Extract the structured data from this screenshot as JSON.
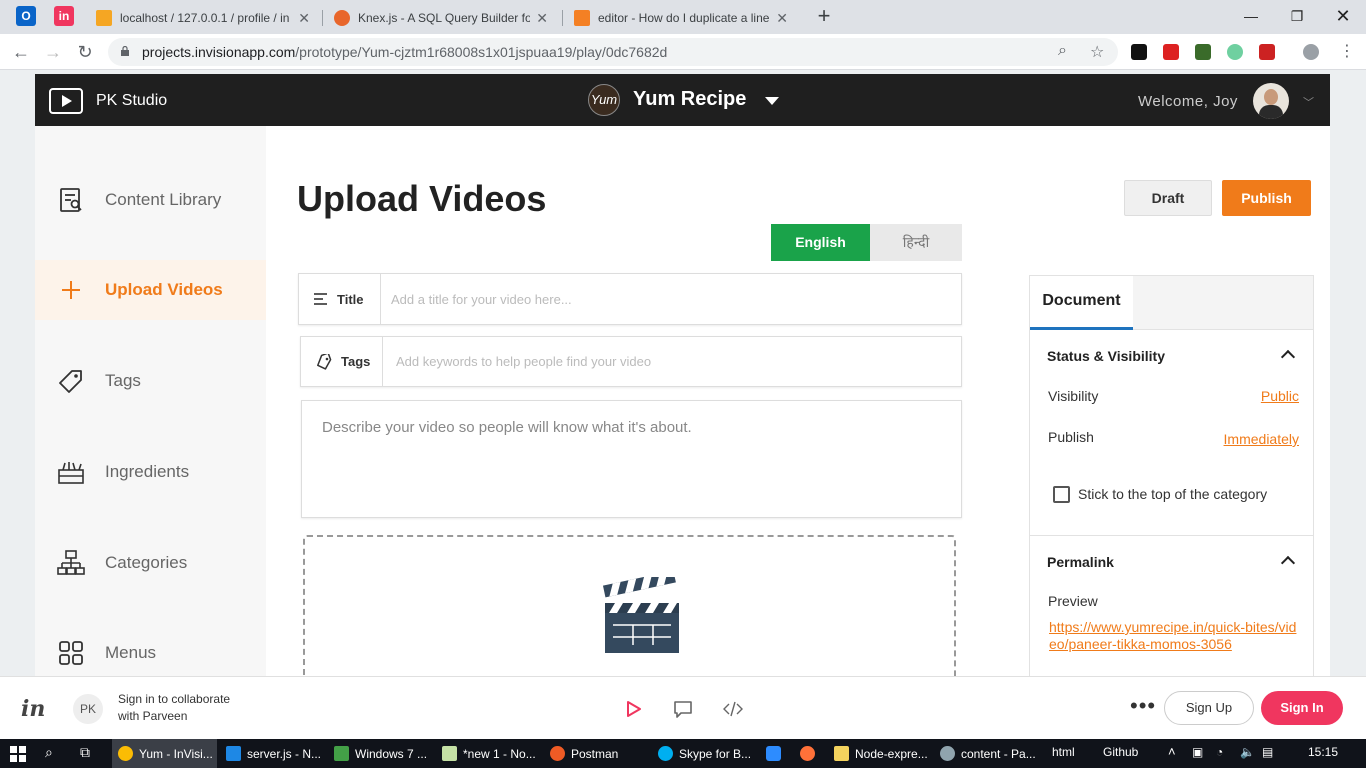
{
  "browser": {
    "tabs": [
      {
        "title": "localhost / 127.0.0.1 / profile / in",
        "favicon": "phpmyadmin-icon"
      },
      {
        "title": "Knex.js - A SQL Query Builder fo",
        "favicon": "knex-icon"
      },
      {
        "title": "editor - How do I duplicate a line",
        "favicon": "stackoverflow-icon"
      }
    ],
    "url_host": "projects.invisionapp.com",
    "url_path": "/prototype/Yum-cjztm1r68008s1x01jspuaa19/play/0dc7682d"
  },
  "header": {
    "studio": "PK Studio",
    "brand_logo_text": "Yum",
    "brand": "Yum Recipe",
    "welcome": "Welcome, Joy"
  },
  "sidebar": {
    "items": [
      {
        "label": "Content Library"
      },
      {
        "label": "Upload Videos"
      },
      {
        "label": "Tags"
      },
      {
        "label": "Ingredients"
      },
      {
        "label": "Categories"
      },
      {
        "label": "Menus"
      }
    ]
  },
  "main": {
    "title": "Upload Videos",
    "draft": "Draft",
    "publish": "Publish",
    "lang_en": "English",
    "lang_hi": "हिन्दी",
    "title_label": "Title",
    "title_placeholder": "Add a title for your video here...",
    "tags_label": "Tags",
    "tags_placeholder": "Add keywords to help people find your video",
    "desc_placeholder": "Describe your video so people will know what it's about."
  },
  "panel": {
    "tab": "Document",
    "status_title": "Status & Visibility",
    "visibility_key": "Visibility",
    "visibility_val": "Public",
    "publish_key": "Publish",
    "publish_val": "Immediately",
    "sticky": "Stick to the top of the category",
    "permalink_title": "Permalink",
    "preview_key": "Preview",
    "preview_url": "https://www.yumrecipe.in/quick-bites/video/paneer-tikka-momos-3056"
  },
  "invbar": {
    "logo": "in",
    "initials": "PK",
    "message": "Sign in to collaborate with Parveen",
    "signup": "Sign Up",
    "signin": "Sign In"
  },
  "taskbar": {
    "items": [
      {
        "label": "Yum - InVisi..."
      },
      {
        "label": "server.js - N..."
      },
      {
        "label": "Windows 7 ..."
      },
      {
        "label": "*new 1 - No..."
      },
      {
        "label": "Postman"
      },
      {
        "label": "Skype for B..."
      },
      {
        "label": "Node-expre..."
      },
      {
        "label": "content - Pa..."
      }
    ],
    "html": "html",
    "github": "Github",
    "time": "15:15"
  },
  "colors": {
    "accent": "#f07b1a",
    "english_active": "#1aa34a",
    "signin": "#f0365f",
    "header_bg": "#1f1f1f"
  }
}
